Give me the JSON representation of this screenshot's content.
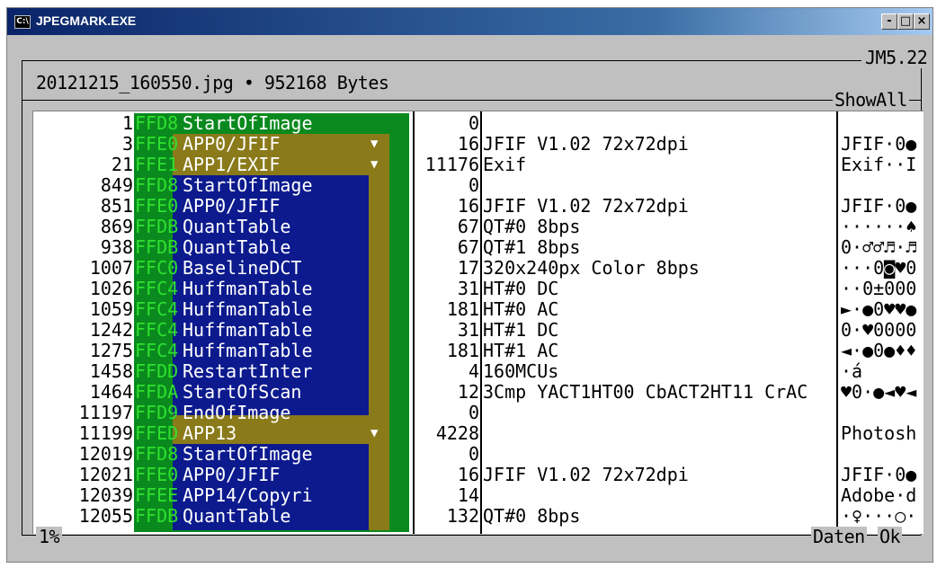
{
  "window": {
    "title": "JPEGMARK.EXE",
    "buttons": {
      "minimize": "-",
      "maximize": "□",
      "close": "×"
    }
  },
  "header": {
    "file_info": "20121215_160550.jpg • 952168 Bytes",
    "version": "JM5.22",
    "mode": "ShowAll"
  },
  "footer": {
    "progress": "1%",
    "button_daten": "Daten",
    "button_ok": "Ok"
  },
  "colors": {
    "green": "#0a8a1e",
    "olive": "#8a7a1a",
    "blue": "#0c1a8e",
    "marker": "#2fe02f"
  },
  "rows": [
    {
      "off": "1",
      "marker": "FFD8",
      "name": "StartOfImage",
      "len": "0",
      "info": "",
      "dump": "",
      "depth": 1,
      "arrow": ""
    },
    {
      "off": "3",
      "marker": "FFE0",
      "name": "APP0/JFIF",
      "len": "16",
      "info": "JFIF V1.02 72x72dpi",
      "dump": "JFIF·0●",
      "depth": 2,
      "arrow": "▼"
    },
    {
      "off": "21",
      "marker": "FFE1",
      "name": "APP1/EXIF",
      "len": "11176",
      "info": "Exif",
      "dump": "Exif··I",
      "depth": 2,
      "arrow": "▼"
    },
    {
      "off": "849",
      "marker": "FFD8",
      "name": "StartOfImage",
      "len": "0",
      "info": "",
      "dump": "",
      "depth": 3,
      "arrow": ""
    },
    {
      "off": "851",
      "marker": "FFE0",
      "name": "APP0/JFIF",
      "len": "16",
      "info": "JFIF V1.02 72x72dpi",
      "dump": "JFIF·0●",
      "depth": 3,
      "arrow": ""
    },
    {
      "off": "869",
      "marker": "FFDB",
      "name": "QuantTable",
      "len": "67",
      "info": "QT#0 8bps",
      "dump": "······♠",
      "depth": 3,
      "arrow": ""
    },
    {
      "off": "938",
      "marker": "FFDB",
      "name": "QuantTable",
      "len": "67",
      "info": "QT#1 8bps",
      "dump": "0·♂♂♬·♬",
      "depth": 3,
      "arrow": ""
    },
    {
      "off": "1007",
      "marker": "FFC0",
      "name": "BaselineDCT",
      "len": "17",
      "info": "320x240px Color 8bps",
      "dump": "···0◙♥0",
      "depth": 3,
      "arrow": ""
    },
    {
      "off": "1026",
      "marker": "FFC4",
      "name": "HuffmanTable",
      "len": "31",
      "info": "HT#0 DC",
      "dump": "··0±000",
      "depth": 3,
      "arrow": ""
    },
    {
      "off": "1059",
      "marker": "FFC4",
      "name": "HuffmanTable",
      "len": "181",
      "info": "HT#0 AC",
      "dump": "►·●0♥♥●",
      "depth": 3,
      "arrow": ""
    },
    {
      "off": "1242",
      "marker": "FFC4",
      "name": "HuffmanTable",
      "len": "31",
      "info": "HT#1 DC",
      "dump": "0·♥0000",
      "depth": 3,
      "arrow": ""
    },
    {
      "off": "1275",
      "marker": "FFC4",
      "name": "HuffmanTable",
      "len": "181",
      "info": "HT#1 AC",
      "dump": "◄·●0●♦♦",
      "depth": 3,
      "arrow": ""
    },
    {
      "off": "1458",
      "marker": "FFDD",
      "name": "RestartInter",
      "len": "4",
      "info": "160MCUs",
      "dump": "·á",
      "depth": 3,
      "arrow": ""
    },
    {
      "off": "1464",
      "marker": "FFDA",
      "name": "StartOfScan",
      "len": "12",
      "info": "3Cmp YACT1HT00 CbACT2HT11 CrAC",
      "dump": "♥0·●◄♥◄",
      "depth": 3,
      "arrow": ""
    },
    {
      "off": "11197",
      "marker": "FFD9",
      "name": "EndOfImage",
      "len": "0",
      "info": "",
      "dump": "",
      "depth": 3,
      "arrow": ""
    },
    {
      "off": "11199",
      "marker": "FFED",
      "name": "APP13",
      "len": "4228",
      "info": "",
      "dump": "Photosh",
      "depth": 2,
      "arrow": "▼"
    },
    {
      "off": "12019",
      "marker": "FFD8",
      "name": "StartOfImage",
      "len": "0",
      "info": "",
      "dump": "",
      "depth": 3,
      "arrow": ""
    },
    {
      "off": "12021",
      "marker": "FFE0",
      "name": "APP0/JFIF",
      "len": "16",
      "info": "JFIF V1.02 72x72dpi",
      "dump": "JFIF·0●",
      "depth": 3,
      "arrow": ""
    },
    {
      "off": "12039",
      "marker": "FFEE",
      "name": "APP14/Copyri",
      "len": "14",
      "info": "",
      "dump": "Adobe·d",
      "depth": 3,
      "arrow": ""
    },
    {
      "off": "12055",
      "marker": "FFDB",
      "name": "QuantTable",
      "len": "132",
      "info": "QT#0 8bps",
      "dump": "·♀···○·",
      "depth": 3,
      "arrow": ""
    }
  ]
}
